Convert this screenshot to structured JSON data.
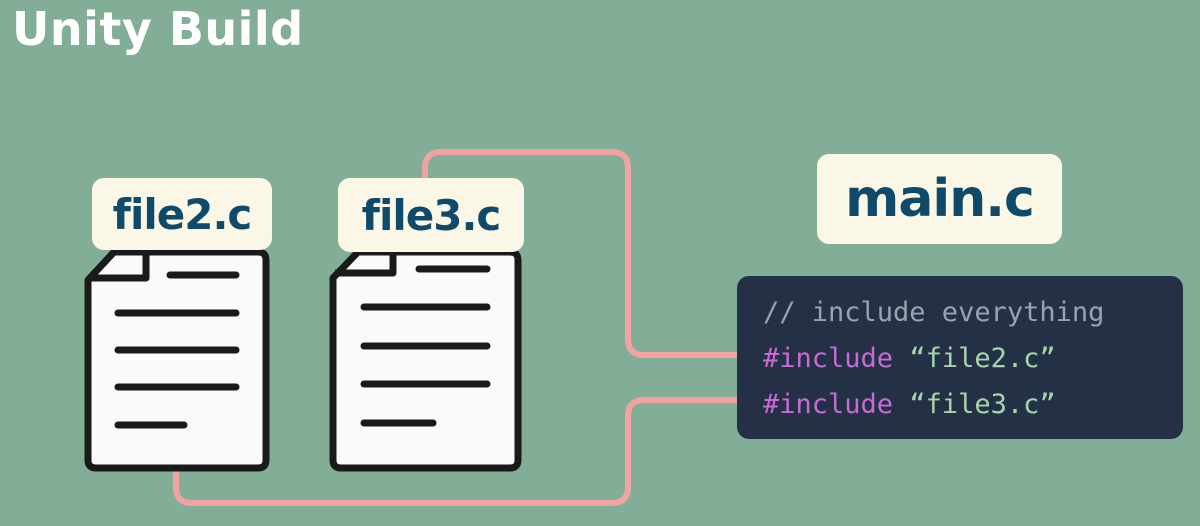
{
  "title": "Unity Build",
  "files": [
    {
      "label": "file2.c"
    },
    {
      "label": "file3.c"
    }
  ],
  "main": {
    "label": "main.c",
    "code": {
      "comment": "// include everything",
      "includes": [
        {
          "directive": "#include",
          "string": "“file2.c”"
        },
        {
          "directive": "#include",
          "string": "“file3.c”"
        }
      ]
    }
  },
  "colors": {
    "background": "#82ae98",
    "connector": "#f0a3a0",
    "label_bg": "#fbf7e6",
    "label_text": "#0f4a6a",
    "code_bg": "#233046",
    "comment": "#9aa2ac",
    "directive": "#c86ad3",
    "string": "#a8d5a8"
  }
}
